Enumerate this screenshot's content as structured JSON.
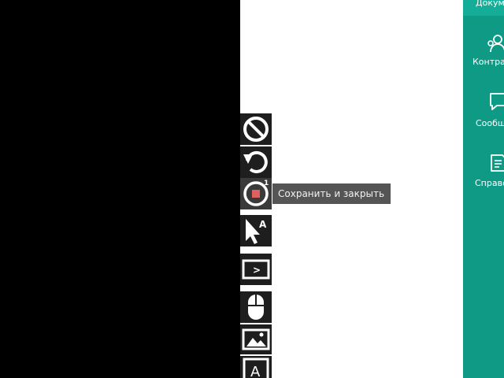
{
  "right_nav": {
    "active_label": "Докум",
    "items": [
      {
        "label": "Контра",
        "icon": "contacts-icon"
      },
      {
        "label": "Сообщ",
        "icon": "message-icon"
      },
      {
        "label": "Справо",
        "icon": "reference-book-icon"
      }
    ]
  },
  "toolbar": {
    "tools": [
      {
        "icon": "cancel-icon"
      },
      {
        "icon": "undo-icon"
      },
      {
        "icon": "record-stop-icon",
        "badge": "1"
      },
      {
        "icon": "cursor-text-icon",
        "glyph": "A"
      },
      {
        "icon": "terminal-icon",
        "glyph": ">"
      },
      {
        "icon": "mouse-icon"
      },
      {
        "icon": "image-icon"
      },
      {
        "icon": "text-icon",
        "glyph": "A"
      }
    ],
    "tooltip": "Сохранить и закрыть"
  },
  "colors": {
    "teal": "#0f9a86",
    "tool_bg": "#1e1e1e",
    "tooltip_bg": "#555555",
    "record_red": "#e06060"
  }
}
